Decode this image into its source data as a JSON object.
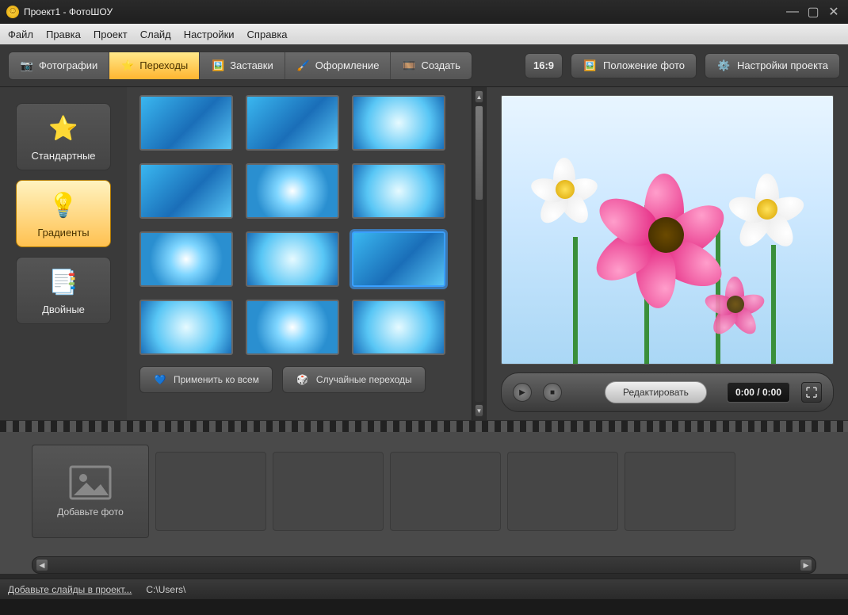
{
  "titlebar": {
    "title": "Проект1 - ФотоШОУ"
  },
  "menubar": [
    "Файл",
    "Правка",
    "Проект",
    "Слайд",
    "Настройки",
    "Справка"
  ],
  "tabs": [
    {
      "label": "Фотографии",
      "icon": "camera"
    },
    {
      "label": "Переходы",
      "icon": "star",
      "active": true
    },
    {
      "label": "Заставки",
      "icon": "picture"
    },
    {
      "label": "Оформление",
      "icon": "brush"
    },
    {
      "label": "Создать",
      "icon": "film"
    }
  ],
  "toolbar_right": {
    "aspect": "16:9",
    "photo_position": "Положение фото",
    "project_settings": "Настройки проекта"
  },
  "categories": [
    {
      "label": "Стандартные",
      "icon": "star"
    },
    {
      "label": "Градиенты",
      "icon": "spotlights",
      "active": true
    },
    {
      "label": "Двойные",
      "icon": "notes"
    }
  ],
  "thumbs": {
    "count": 12,
    "selected_index": 8
  },
  "thumb_actions": {
    "apply_all": "Применить ко всем",
    "random": "Случайные переходы"
  },
  "preview": {
    "edit": "Редактировать",
    "time": "0:00 / 0:00"
  },
  "slide_slot": {
    "placeholder": "Добавьте фото"
  },
  "statusbar": {
    "hint": "Добавьте слайды в проект...",
    "path": "C:\\Users\\"
  }
}
